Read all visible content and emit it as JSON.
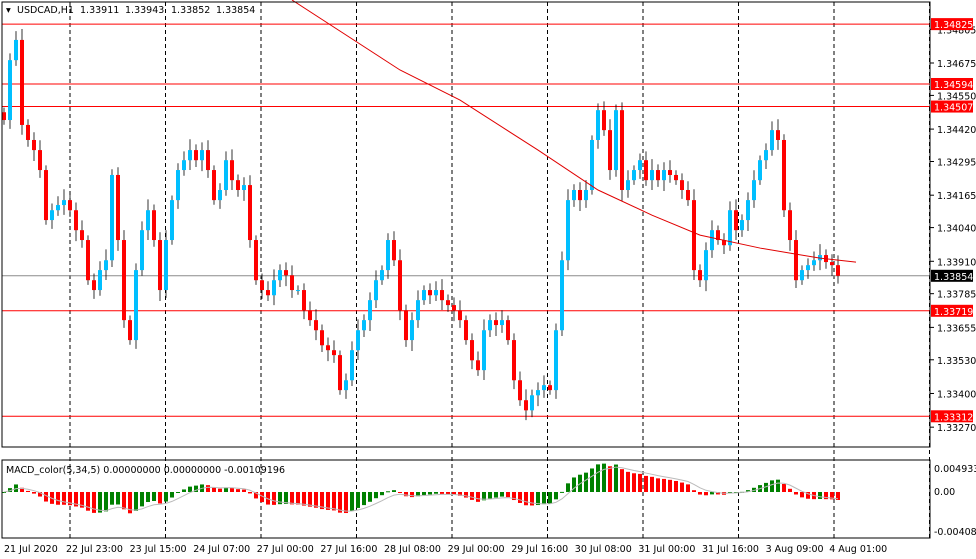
{
  "header": {
    "symbol": "USDCAD,H1",
    "open": "1.33911",
    "high": "1.33943",
    "low": "1.33852",
    "close": "1.33854"
  },
  "indicator": {
    "label": "MACD_color(5,34,5) 0.00000000 0.00000000 -0.00109196",
    "max": "0.0049339",
    "zero": "0.00",
    "min": "-0.0040807"
  },
  "colors": {
    "up": "#00bfff",
    "down": "#ff0000",
    "level": "#ff0000",
    "ma": "#e00000",
    "hist_up": "#008000",
    "hist_down": "#ff0000"
  },
  "chart_data": {
    "type": "candlestick",
    "price_ticks": [
      "1.34805",
      "1.34675",
      "1.34550",
      "1.34420",
      "1.34295",
      "1.34165",
      "1.34040",
      "1.33910",
      "1.33785",
      "1.33655",
      "1.33530",
      "1.33400",
      "1.33270"
    ],
    "ylim": [
      1.3323,
      1.34918
    ],
    "levels": [
      {
        "label": "1.34825",
        "value": 1.34825,
        "color": "#ff0000"
      },
      {
        "label": "1.34594",
        "value": 1.34594,
        "color": "#ff0000"
      },
      {
        "label": "1.34507",
        "value": 1.34507,
        "color": "#ff0000"
      },
      {
        "label": "1.33719",
        "value": 1.33719,
        "color": "#ff0000"
      },
      {
        "label": "1.33312",
        "value": 1.33312,
        "color": "#ff0000"
      },
      {
        "label": "1.33854",
        "value": 1.33854,
        "color": "#000000"
      }
    ],
    "x_labels": [
      "21 Jul 2020",
      "22 Jul 23:00",
      "23 Jul 15:00",
      "24 Jul 07:00",
      "27 Jul 00:00",
      "27 Jul 16:00",
      "28 Jul 08:00",
      "29 Jul 00:00",
      "29 Jul 16:00",
      "30 Jul 08:00",
      "31 Jul 00:00",
      "31 Jul 16:00",
      "3 Aug 09:00",
      "4 Aug 01:00"
    ],
    "closes": [
      1.34455,
      1.34686,
      1.34764,
      1.34436,
      1.34378,
      1.34339,
      1.34262,
      1.34069,
      1.34107,
      1.34127,
      1.34146,
      1.34107,
      1.3403,
      1.33992,
      1.33837,
      1.33799,
      1.33876,
      1.33914,
      1.34243,
      1.33992,
      1.33683,
      1.33606,
      1.33876,
      1.3403,
      1.34107,
      1.33992,
      1.33799,
      1.33992,
      1.34146,
      1.34262,
      1.343,
      1.34339,
      1.343,
      1.34339,
      1.34262,
      1.34146,
      1.34185,
      1.343,
      1.34223,
      1.34185,
      1.34204,
      1.33992,
      1.33837,
      1.33799,
      1.33779,
      1.33837,
      1.33876,
      1.33856,
      1.33799,
      1.33799,
      1.33721,
      1.33683,
      1.33644,
      1.33586,
      1.33567,
      1.33548,
      1.33413,
      1.33451,
      1.33567,
      1.33644,
      1.33683,
      1.3376,
      1.33837,
      1.33876,
      1.33992,
      1.33914,
      1.33721,
      1.33606,
      1.33683,
      1.3376,
      1.33799,
      1.33779,
      1.33799,
      1.3376,
      1.33741,
      1.33721,
      1.33683,
      1.33606,
      1.33528,
      1.3349,
      1.33644,
      1.33683,
      1.33664,
      1.33683,
      1.33606,
      1.33451,
      1.33374,
      1.33335,
      1.33393,
      1.33413,
      1.33432,
      1.33413,
      1.33644,
      1.33914,
      1.34146,
      1.34185,
      1.34146,
      1.34185,
      1.34378,
      1.34493,
      1.34416,
      1.34262,
      1.34493,
      1.34185,
      1.34223,
      1.34262,
      1.343,
      1.34223,
      1.34262,
      1.34223,
      1.34262,
      1.34243,
      1.34223,
      1.34185,
      1.34146,
      1.33876,
      1.33837,
      1.33953,
      1.3403,
      1.33992,
      1.33972,
      1.34107,
      1.3403,
      1.34069,
      1.34146,
      1.34223,
      1.343,
      1.34339,
      1.34416,
      1.34378,
      1.34107,
      1.33992,
      1.33837,
      1.33876,
      1.33895,
      1.33914,
      1.33934,
      1.33907,
      1.33895,
      1.33854
    ],
    "ma": [
      [
        48,
        1.34918
      ],
      [
        66,
        1.34648
      ],
      [
        76,
        1.34532
      ],
      [
        89,
        1.34339
      ],
      [
        99,
        1.34185
      ],
      [
        108,
        1.34088
      ],
      [
        116,
        1.34011
      ],
      [
        126,
        1.33961
      ],
      [
        136,
        1.33922
      ],
      [
        142,
        1.33907
      ]
    ]
  }
}
